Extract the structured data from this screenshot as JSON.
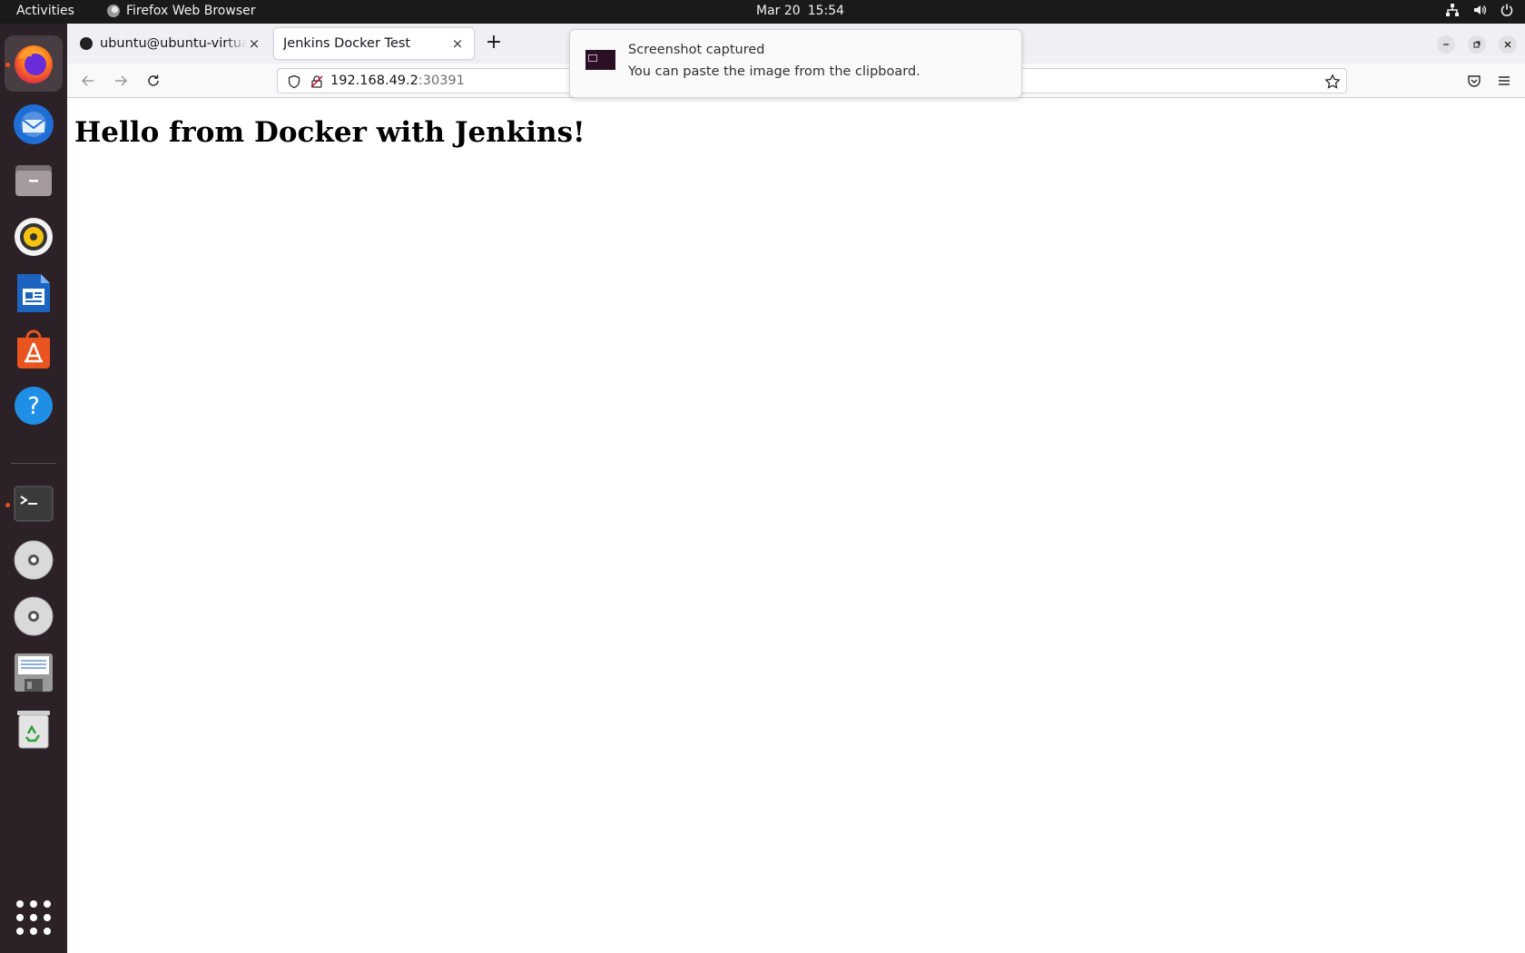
{
  "topbar": {
    "activities": "Activities",
    "app_name": "Firefox Web Browser",
    "date": "Mar 20",
    "time": "15:54"
  },
  "dock": {
    "items": [
      {
        "name": "firefox",
        "running": true,
        "active": true
      },
      {
        "name": "thunderbird"
      },
      {
        "name": "files"
      },
      {
        "name": "rhythmbox"
      },
      {
        "name": "libreoffice-writer"
      },
      {
        "name": "app-center"
      },
      {
        "name": "help"
      },
      {
        "name": "terminal",
        "running": true
      },
      {
        "name": "dvd-drive-1"
      },
      {
        "name": "dvd-drive-2"
      },
      {
        "name": "floppy-drive"
      },
      {
        "name": "trash"
      }
    ]
  },
  "browser": {
    "tabs": [
      {
        "title": "ubuntu@ubuntu-virtual-machine",
        "close": "×"
      },
      {
        "title": "Jenkins Docker Test",
        "close": "×",
        "active": true
      }
    ],
    "new_tab": "+",
    "url_host": "192.168.49.2",
    "url_port": ":30391"
  },
  "page": {
    "heading": "Hello from Docker with Jenkins!"
  },
  "notification": {
    "title": "Screenshot captured",
    "body": "You can paste the image from the clipboard."
  },
  "colors": {
    "accent": "#e95420",
    "dock_bg": "#2c2127",
    "topbar_bg": "#1a1a1a"
  }
}
